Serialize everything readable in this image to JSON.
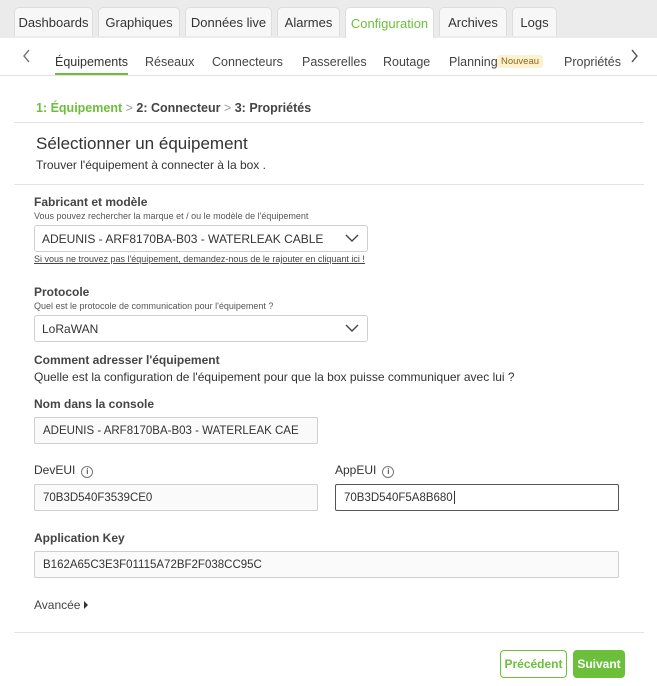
{
  "top_tabs": [
    {
      "label": "Dashboards"
    },
    {
      "label": "Graphiques"
    },
    {
      "label": "Données live"
    },
    {
      "label": "Alarmes"
    },
    {
      "label": "Configuration"
    },
    {
      "label": "Archives"
    },
    {
      "label": "Logs"
    }
  ],
  "active_top_tab": "Configuration",
  "sub_tabs": [
    {
      "label": "Équipements"
    },
    {
      "label": "Réseaux"
    },
    {
      "label": "Connecteurs"
    },
    {
      "label": "Passerelles"
    },
    {
      "label": "Routage"
    },
    {
      "label": "Planning"
    },
    {
      "label": "Propriétés"
    }
  ],
  "active_sub_tab": "Équipements",
  "planning_badge": "Nouveau",
  "stepper": {
    "step1": "1:  Équipement",
    "sep1": ">",
    "step2": "2:  Connecteur",
    "sep2": ">",
    "step3": "3:  Propriétés"
  },
  "page": {
    "title": "Sélectionner un équipement",
    "subtitle": "Trouver l'équipement à connecter à la box ."
  },
  "manufacturer": {
    "label": "Fabricant et modèle",
    "hint": "Vous pouvez rechercher la marque et / ou le modèle de l'équipement",
    "value": "ADEUNIS - ARF8170BA-B03 - WATERLEAK CABLE",
    "link": "Si vous ne trouvez pas l'équipement, demandez-nous de le rajouter en cliquant ici !"
  },
  "protocol": {
    "label": "Protocole",
    "hint": "Quel est le protocole de communication pour l'équipement ?",
    "value": "LoRaWAN"
  },
  "addressing": {
    "label": "Comment adresser l'équipement",
    "text": "Quelle est la configuration de l'équipement pour que la box puisse communiquer avec lui ?"
  },
  "console_name": {
    "label": "Nom dans la console",
    "value": "ADEUNIS - ARF8170BA-B03 - WATERLEAK CAE"
  },
  "dev_eui": {
    "label": "DevEUI",
    "value": "70B3D540F3539CE0"
  },
  "app_eui": {
    "label": "AppEUI",
    "value": "70B3D540F5A8B680"
  },
  "app_key": {
    "label": "Application Key",
    "value": "B162A65C3E3F01115A72BF2F038CC95C"
  },
  "advanced_label": "Avancée",
  "buttons": {
    "previous": "Précédent",
    "next": "Suivant"
  },
  "colors": {
    "accent": "#6cbf3b",
    "badge_bg": "#fdf1cf"
  },
  "icons": {
    "info": "info-circle-icon",
    "dropdown": "chevron-down-icon",
    "advanced": "caret-right-icon"
  }
}
